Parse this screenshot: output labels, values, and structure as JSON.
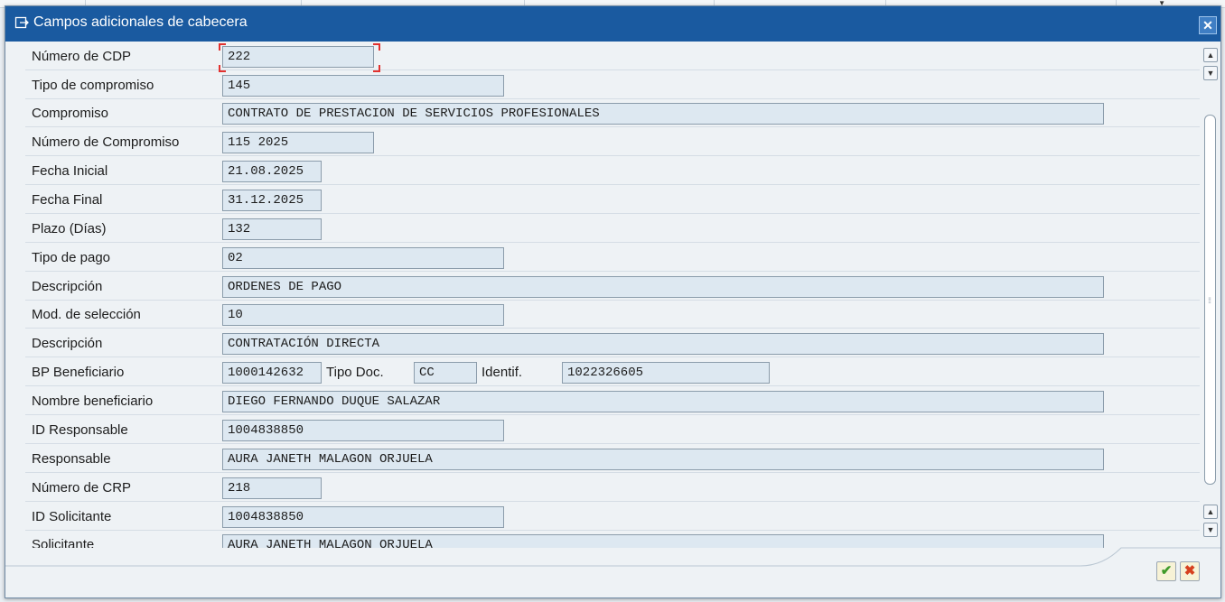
{
  "dialog": {
    "title": "Campos adicionales de cabecera",
    "close_icon": "close-icon",
    "title_icon": "window-arrow-icon"
  },
  "fields": [
    {
      "label": "Número de CDP",
      "value": "222"
    },
    {
      "label": "Tipo de compromiso",
      "value": "145"
    },
    {
      "label": "Compromiso",
      "value": "CONTRATO DE PRESTACION DE SERVICIOS PROFESIONALES"
    },
    {
      "label": "Número de Compromiso",
      "value": "115 2025"
    },
    {
      "label": "Fecha Inicial",
      "value": "21.08.2025"
    },
    {
      "label": "Fecha Final",
      "value": "31.12.2025"
    },
    {
      "label": "Plazo (Días)",
      "value": "132"
    },
    {
      "label": "Tipo de pago",
      "value": "02"
    },
    {
      "label": "Descripción",
      "value": "ORDENES DE PAGO"
    },
    {
      "label": "Mod. de selección",
      "value": "10"
    },
    {
      "label": "Descripción",
      "value": "CONTRATACIÓN DIRECTA"
    },
    {
      "label": "BP Beneficiario",
      "value": "1000142632",
      "tipo_doc_label": "Tipo Doc.",
      "tipo_doc_value": "CC",
      "identif_label": "Identif.",
      "identif_value": "1022326605"
    },
    {
      "label": "Nombre beneficiario",
      "value": "DIEGO FERNANDO DUQUE SALAZAR"
    },
    {
      "label": "ID Responsable",
      "value": "1004838850"
    },
    {
      "label": "Responsable",
      "value": "AURA JANETH MALAGON ORJUELA"
    },
    {
      "label": "Número de CRP",
      "value": "218"
    },
    {
      "label": "ID Solicitante",
      "value": "1004838850"
    },
    {
      "label": "Solicitante",
      "value": "AURA JANETH MALAGON ORJUELA"
    }
  ],
  "buttons": {
    "ok_icon": "check-icon",
    "cancel_icon": "cancel-x-icon"
  },
  "colors": {
    "titlebar": "#1a5aa0",
    "field_bg": "#dde8f1",
    "focus": "#e2322f"
  }
}
